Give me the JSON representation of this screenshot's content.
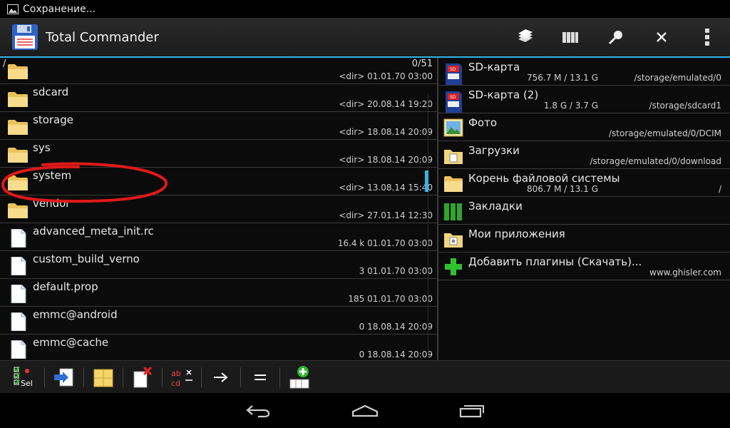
{
  "status_bar": {
    "notification_text": "Сохранение...",
    "notification_icon": "image-icon"
  },
  "app": {
    "title": "Total Commander",
    "icon": "floppy-disk-icon",
    "accent_color": "#33b5e5"
  },
  "action_bar": {
    "actions": [
      {
        "name": "copy-action",
        "icon": "files-stack-icon"
      },
      {
        "name": "library-action",
        "icon": "books-icon"
      },
      {
        "name": "search-action",
        "icon": "magnifier-icon"
      },
      {
        "name": "close-action",
        "icon": "close-icon"
      },
      {
        "name": "overflow-menu",
        "icon": "more-vert-icon"
      }
    ]
  },
  "left_panel": {
    "path": "/",
    "count": "0/51",
    "files": [
      {
        "name": "",
        "type": "folder",
        "size": "<dir>",
        "date": "01.01.70",
        "time": "03:00"
      },
      {
        "name": "sdcard",
        "type": "folder",
        "size": "<dir>",
        "date": "20.08.14",
        "time": "19:20"
      },
      {
        "name": "storage",
        "type": "folder",
        "size": "<dir>",
        "date": "18.08.14",
        "time": "20:09"
      },
      {
        "name": "sys",
        "type": "folder",
        "size": "<dir>",
        "date": "18.08.14",
        "time": "20:09"
      },
      {
        "name": "system",
        "type": "folder",
        "size": "<dir>",
        "date": "13.08.14",
        "time": "15:40"
      },
      {
        "name": "vendor",
        "type": "folder",
        "size": "<dir>",
        "date": "27.01.14",
        "time": "12:30"
      },
      {
        "name": "advanced_meta_init.rc",
        "type": "file",
        "size": "16.4 k",
        "date": "01.01.70",
        "time": "03:00"
      },
      {
        "name": "custom_build_verno",
        "type": "file",
        "size": "3",
        "date": "01.01.70",
        "time": "03:00"
      },
      {
        "name": "default.prop",
        "type": "file",
        "size": "185",
        "date": "01.01.70",
        "time": "03:00"
      },
      {
        "name": "emmc@android",
        "type": "file",
        "size": "0",
        "date": "18.08.14",
        "time": "20:09"
      },
      {
        "name": "emmc@cache",
        "type": "file",
        "size": "0",
        "date": "18.08.14",
        "time": "20:09"
      }
    ]
  },
  "right_panel": {
    "locations": [
      {
        "name": "SD-карта",
        "size": "756.7 M / 13.1 G",
        "path": "/storage/emulated/0",
        "icon": "sd-card-icon"
      },
      {
        "name": "SD-карта (2)",
        "size": "1.8 G / 3.7 G",
        "path": "/storage/sdcard1",
        "icon": "sd-card-icon"
      },
      {
        "name": "Фото",
        "size": "",
        "path": "/storage/emulated/0/DCIM",
        "icon": "photo-icon"
      },
      {
        "name": "Загрузки",
        "size": "",
        "path": "/storage/emulated/0/download",
        "icon": "downloads-folder-icon"
      },
      {
        "name": "Корень файловой системы",
        "size": "806.7 M / 13.1 G",
        "path": "/",
        "icon": "folder-icon"
      },
      {
        "name": "Закладки",
        "size": "",
        "path": "",
        "icon": "bookmarks-icon"
      },
      {
        "name": "Мои приложения",
        "size": "",
        "path": "",
        "icon": "apps-folder-icon"
      },
      {
        "name": "Добавить плагины (Скачать)...",
        "size": "",
        "path": "www.ghisler.com",
        "icon": "plus-icon"
      }
    ]
  },
  "toolbar": {
    "select_label": "Sel",
    "rename_label_top": "ab",
    "rename_label_bottom": "cd",
    "buttons": [
      {
        "name": "select-button",
        "icon": "select-icon"
      },
      {
        "name": "copy-button",
        "icon": "copy-icon"
      },
      {
        "name": "pack-button",
        "icon": "pack-icon"
      },
      {
        "name": "delete-button",
        "icon": "delete-icon"
      },
      {
        "name": "rename-button",
        "icon": "rename-icon"
      },
      {
        "name": "target-button",
        "icon": "arrow-right-icon"
      },
      {
        "name": "equal-panels-button",
        "icon": "equals-icon"
      },
      {
        "name": "add-button-button",
        "icon": "add-button-icon"
      }
    ]
  },
  "navigation": {
    "buttons": [
      "back-icon",
      "home-icon",
      "recents-icon"
    ]
  }
}
